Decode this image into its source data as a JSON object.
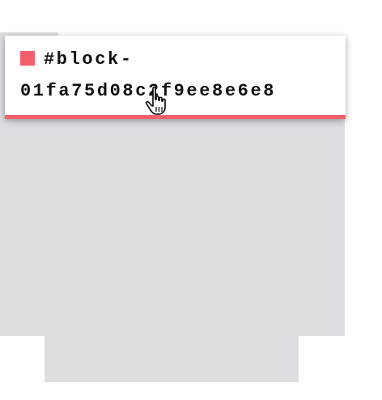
{
  "block": {
    "id_line_1": "#block-",
    "id_line_2": "01fa75d08c2f9ee8e6e8",
    "swatch_color": "#f25f6c",
    "accent_color": "#f25f6c"
  },
  "background": {
    "panel_color": "#dfdde2"
  },
  "cursor": {
    "icon": "hand-pointer-icon"
  }
}
